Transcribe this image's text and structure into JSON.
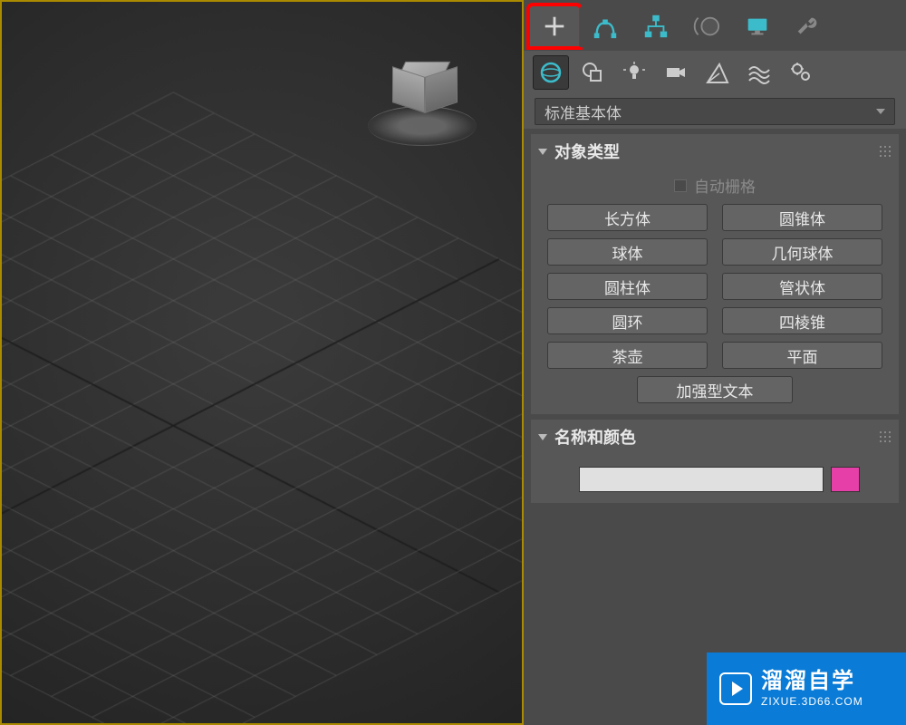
{
  "dropdown": {
    "label": "标准基本体"
  },
  "rollouts": {
    "object_type": {
      "title": "对象类型",
      "autogrid": "自动栅格",
      "buttons": [
        "长方体",
        "圆锥体",
        "球体",
        "几何球体",
        "圆柱体",
        "管状体",
        "圆环",
        "四棱锥",
        "茶壶",
        "平面",
        "加强型文本"
      ]
    },
    "name_color": {
      "title": "名称和颜色",
      "name_value": "",
      "color": "#e63fa7"
    }
  },
  "watermark": {
    "title": "溜溜自学",
    "url": "ZIXUE.3D66.COM"
  },
  "tabs": {
    "create": "create",
    "modify": "modify",
    "hierarchy": "hierarchy",
    "motion": "motion",
    "display": "display",
    "utilities": "utilities"
  },
  "subtabs": {
    "geometry": "geometry",
    "shapes": "shapes",
    "lights": "lights",
    "cameras": "cameras",
    "helpers": "helpers",
    "spacewarps": "spacewarps",
    "systems": "systems"
  }
}
